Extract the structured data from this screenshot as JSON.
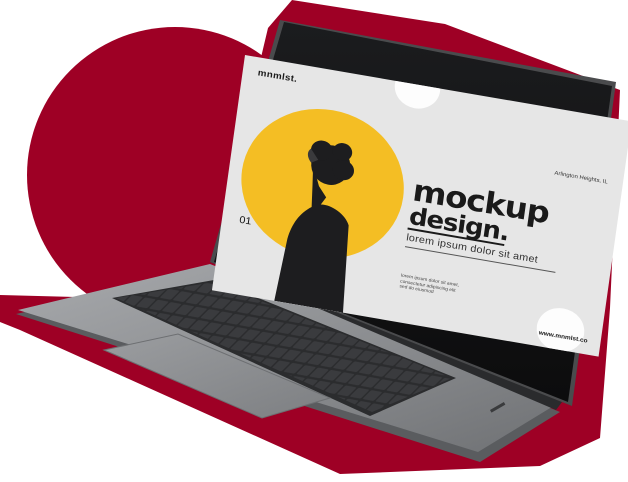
{
  "scene": {
    "background_color": "#ffffff",
    "blob_color": "#9e0025",
    "laptop_body_color": "#8d8f92",
    "keyboard_color": "#2b2c2e"
  },
  "screen": {
    "brand": "mnmlst.",
    "location": "Arlington Heights, IL",
    "headline_line1": "mockup",
    "headline_line2": "design.",
    "tagline": "lorem ipsum dolor sit amet",
    "page_number": "01",
    "small_note": "lorem ipsum dolor sit amet, consectetur adipiscing elit sed do eiusmod",
    "website": "www.mnmlst.co",
    "accent_color": "#f4be24",
    "screen_bg": "#e6e6e6"
  }
}
